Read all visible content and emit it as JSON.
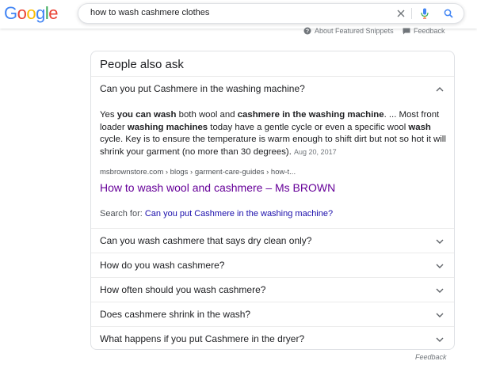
{
  "logo": {
    "text": "Google",
    "letters": [
      {
        "ch": "G",
        "color": "#4285F4"
      },
      {
        "ch": "o",
        "color": "#EA4335"
      },
      {
        "ch": "o",
        "color": "#FBBC05"
      },
      {
        "ch": "g",
        "color": "#4285F4"
      },
      {
        "ch": "l",
        "color": "#34A853"
      },
      {
        "ch": "e",
        "color": "#EA4335"
      }
    ]
  },
  "search": {
    "query": "how to wash cashmere clothes"
  },
  "meta": {
    "about": "About Featured Snippets",
    "feedback": "Feedback"
  },
  "paa": {
    "title": "People also ask",
    "expanded": {
      "question": "Can you put Cashmere in the washing machine?",
      "answer": {
        "p1": "Yes ",
        "b1": "you can wash",
        "p2": " both wool and ",
        "b2": "cashmere in the washing machine",
        "p3": ". ... Most front loader ",
        "b3": "washing machines",
        "p4": " today have a gentle cycle or even a specific wool ",
        "b4": "wash",
        "p5": " cycle. Key is to ensure the temperature is warm enough to shift dirt but not so hot it will shrink your garment (no more than 30 degrees).",
        "date": "Aug 20, 2017"
      },
      "cite": "msbrownstore.com › blogs › garment-care-guides › how-t...",
      "link": "How to wash wool and cashmere – Ms BROWN",
      "search_for_label": "Search for: ",
      "search_for_link": "Can you put Cashmere in the washing machine?"
    },
    "questions": [
      "Can you wash cashmere that says dry clean only?",
      "How do you wash cashmere?",
      "How often should you wash cashmere?",
      "Does cashmere shrink in the wash?",
      "What happens if you put Cashmere in the dryer?"
    ]
  },
  "footer": {
    "feedback": "Feedback"
  },
  "colors": {
    "link": "#1a0dab",
    "visited": "#660099",
    "accent": "#4285F4"
  }
}
